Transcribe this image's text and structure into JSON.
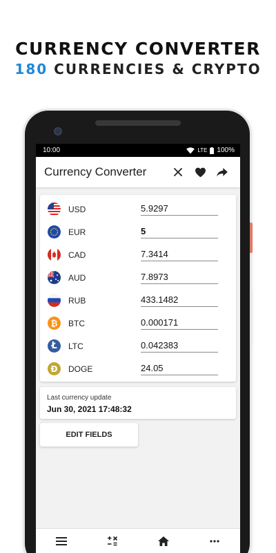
{
  "promo": {
    "title": "CURRENCY CONVERTER",
    "subtitle_number": "180",
    "subtitle_text": " CURRENCIES & CRYPTO",
    "accent_color": "#1e88d8"
  },
  "statusbar": {
    "time": "10:00",
    "network": "LTE",
    "battery": "100%"
  },
  "appbar": {
    "title": "Currency Converter",
    "actions": [
      "close-icon",
      "heart-icon",
      "share-icon"
    ]
  },
  "currencies": [
    {
      "code": "USD",
      "value": "5.9297",
      "icon": "us-flag-icon"
    },
    {
      "code": "EUR",
      "value": "5",
      "icon": "eu-flag-icon",
      "active": true
    },
    {
      "code": "CAD",
      "value": "7.3414",
      "icon": "canada-flag-icon"
    },
    {
      "code": "AUD",
      "value": "7.8973",
      "icon": "australia-flag-icon"
    },
    {
      "code": "RUB",
      "value": "433.1482",
      "icon": "russia-flag-icon"
    },
    {
      "code": "BTC",
      "value": "0.000171",
      "icon": "bitcoin-icon",
      "color": "#f7931a"
    },
    {
      "code": "LTC",
      "value": "0.042383",
      "icon": "litecoin-icon",
      "color": "#345d9d"
    },
    {
      "code": "DOGE",
      "value": "24.05",
      "icon": "dogecoin-icon",
      "color": "#c2a633"
    }
  ],
  "update": {
    "label": "Last currency update",
    "date": "Jun 30, 2021 17:48:32"
  },
  "edit_button": "EDIT FIELDS",
  "bottom_nav": [
    "menu-icon",
    "calculator-icon",
    "home-icon",
    "more-icon"
  ]
}
